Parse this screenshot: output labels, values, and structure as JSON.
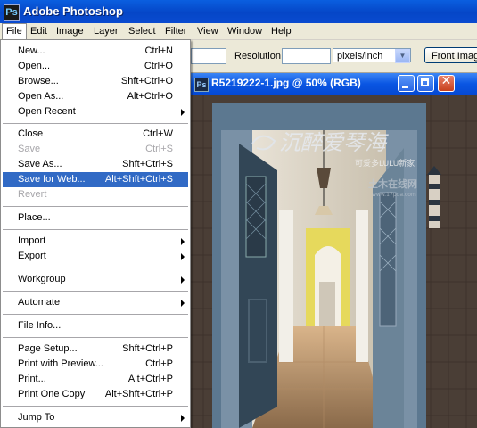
{
  "app": {
    "title": "Adobe Photoshop",
    "icon": "photoshop-app-icon"
  },
  "menubar": {
    "items": [
      {
        "label": "File"
      },
      {
        "label": "Edit"
      },
      {
        "label": "Image"
      },
      {
        "label": "Layer"
      },
      {
        "label": "Select"
      },
      {
        "label": "Filter"
      },
      {
        "label": "View"
      },
      {
        "label": "Window"
      },
      {
        "label": "Help"
      }
    ]
  },
  "options": {
    "resolution_label": "Resolution:",
    "resolution_unit": "pixels/inch",
    "front_image_button": "Front Image"
  },
  "document": {
    "title": "R5219222-1.jpg @ 50% (RGB)",
    "watermark_calligraphy": "沉醉爱琴海",
    "watermark_small": "可爱多LULU新家",
    "watermark_site": "土木在线网",
    "watermark_url": "www.17pqa.com"
  },
  "file_menu": {
    "items": [
      {
        "label": "New...",
        "shortcut": "Ctrl+N"
      },
      {
        "label": "Open...",
        "shortcut": "Ctrl+O"
      },
      {
        "label": "Browse...",
        "shortcut": "Shft+Ctrl+O"
      },
      {
        "label": "Open As...",
        "shortcut": "Alt+Ctrl+O"
      },
      {
        "label": "Open Recent",
        "shortcut": ""
      },
      {
        "label": "Close",
        "shortcut": "Ctrl+W"
      },
      {
        "label": "Save",
        "shortcut": "Ctrl+S"
      },
      {
        "label": "Save As...",
        "shortcut": "Shft+Ctrl+S"
      },
      {
        "label": "Save for Web...",
        "shortcut": "Alt+Shft+Ctrl+S"
      },
      {
        "label": "Revert",
        "shortcut": ""
      },
      {
        "label": "Place...",
        "shortcut": ""
      },
      {
        "label": "Import",
        "shortcut": ""
      },
      {
        "label": "Export",
        "shortcut": ""
      },
      {
        "label": "Workgroup",
        "shortcut": ""
      },
      {
        "label": "Automate",
        "shortcut": ""
      },
      {
        "label": "File Info...",
        "shortcut": ""
      },
      {
        "label": "Page Setup...",
        "shortcut": "Shft+Ctrl+P"
      },
      {
        "label": "Print with Preview...",
        "shortcut": "Ctrl+P"
      },
      {
        "label": "Print...",
        "shortcut": "Alt+Ctrl+P"
      },
      {
        "label": "Print One Copy",
        "shortcut": "Alt+Shft+Ctrl+P"
      },
      {
        "label": "Jump To",
        "shortcut": ""
      }
    ]
  },
  "colors": {
    "titlebar": "#0546c7",
    "menu_highlight": "#316ac5",
    "disabled_text": "#a7a6aa"
  }
}
